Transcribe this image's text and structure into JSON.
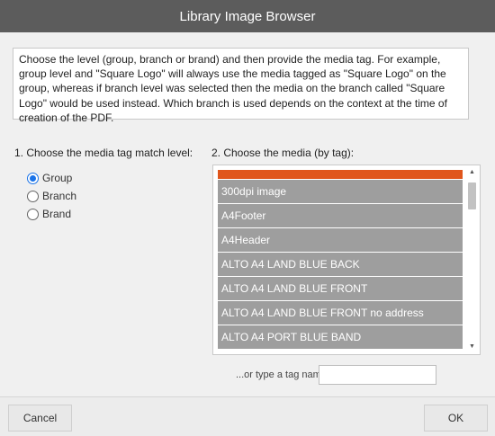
{
  "window": {
    "title": "Library Image Browser"
  },
  "description": "Choose the level (group, branch or brand) and then provide the media tag. For example, group level and \"Square Logo\" will always use the media tagged as \"Square Logo\" on the group, whereas if branch level was selected then the media on the branch called \"Square Logo\" would be used instead. Which branch is used depends on the context at the time of creation of the PDF.",
  "level_section": {
    "label": "1. Choose the media tag match level:",
    "options": [
      {
        "label": "Group",
        "checked": true
      },
      {
        "label": "Branch",
        "checked": false
      },
      {
        "label": "Brand",
        "checked": false
      }
    ]
  },
  "media_section": {
    "label": "2. Choose the media (by tag):",
    "items": [
      "300dpi image",
      "A4Footer",
      "A4Header",
      "ALTO A4 LAND BLUE BACK",
      "ALTO A4 LAND BLUE FRONT",
      "ALTO A4 LAND BLUE FRONT no address",
      "ALTO A4 PORT BLUE BAND"
    ],
    "accent_color": "#e0561c",
    "item_color": "#9e9e9e"
  },
  "tag_input": {
    "label": "...or type a tag name:",
    "value": "",
    "placeholder": ""
  },
  "footer": {
    "cancel_label": "Cancel",
    "ok_label": "OK"
  }
}
